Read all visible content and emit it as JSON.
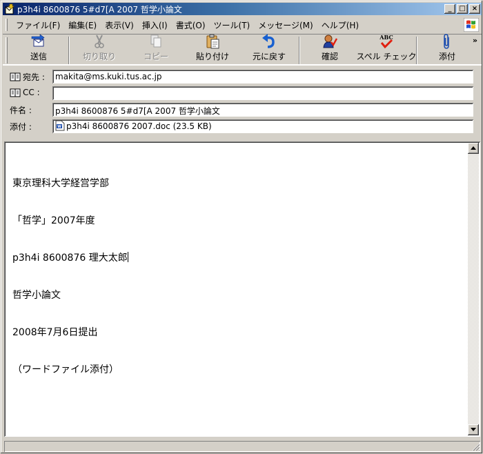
{
  "window": {
    "title": "p3h4i 8600876 5#d7[A 2007 哲学小論文",
    "minimize_glyph": "_",
    "maximize_glyph": "□",
    "close_glyph": "×"
  },
  "menu": {
    "items": [
      {
        "label": "ファイル(F)"
      },
      {
        "label": "編集(E)"
      },
      {
        "label": "表示(V)"
      },
      {
        "label": "挿入(I)"
      },
      {
        "label": "書式(O)"
      },
      {
        "label": "ツール(T)"
      },
      {
        "label": "メッセージ(M)"
      },
      {
        "label": "ヘルプ(H)"
      }
    ]
  },
  "toolbar": {
    "send": {
      "label": "送信",
      "icon": "send-icon"
    },
    "cut": {
      "label": "切り取り",
      "icon": "scissors-icon",
      "disabled": true
    },
    "copy": {
      "label": "コピー",
      "icon": "copy-icon",
      "disabled": true
    },
    "paste": {
      "label": "貼り付け",
      "icon": "paste-icon"
    },
    "undo": {
      "label": "元に戻す",
      "icon": "undo-icon"
    },
    "check": {
      "label": "確認",
      "icon": "check-names-icon"
    },
    "spelling": {
      "label": "スペル チェック",
      "icon": "spellcheck-icon",
      "icon_text": "ABC"
    },
    "attach": {
      "label": "添付",
      "icon": "paperclip-icon"
    },
    "more": "»"
  },
  "header": {
    "to_label": "宛先 :",
    "to_value": "makita@ms.kuki.tus.ac.jp",
    "cc_label": "CC :",
    "cc_value": "",
    "subject_label": "件名 :",
    "subject_value": "p3h4i 8600876 5#d7[A 2007 哲学小論文",
    "attach_label": "添付 :",
    "attach_value": "p3h4i 8600876 2007.doc (23.5 KB)"
  },
  "body": {
    "lines": [
      "東京理科大学経営学部",
      "「哲学」2007年度",
      "p3h4i 8600876 理大太郎",
      "哲学小論文",
      "2008年7月6日提出",
      "（ワードファイル添付）"
    ]
  },
  "colors": {
    "title_gradient_start": "#0a246a",
    "title_gradient_end": "#a6caf0",
    "face": "#d4d0c8"
  }
}
